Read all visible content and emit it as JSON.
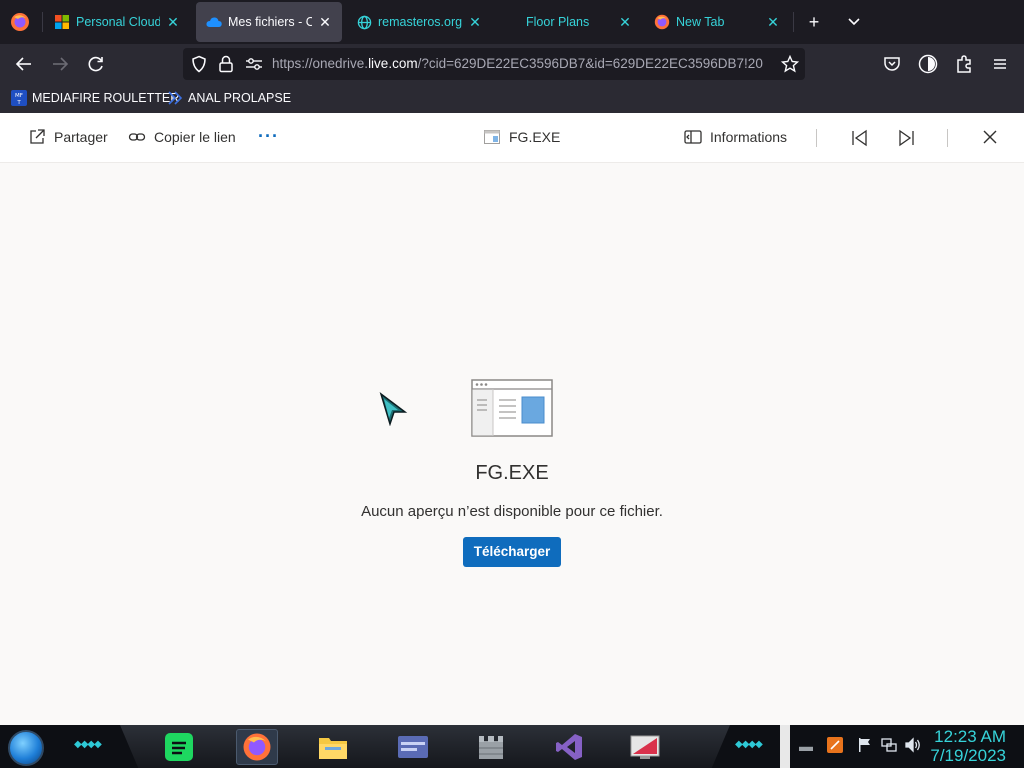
{
  "browser": {
    "tabs": [
      {
        "title": "Personal Cloud S",
        "favicon": "microsoft-logo-icon",
        "active": false
      },
      {
        "title": "Mes fichiers - One",
        "favicon": "onedrive-cloud-icon",
        "active": true
      },
      {
        "title": "remasteros.org/i",
        "favicon": "globe-icon",
        "active": false
      },
      {
        "title": "Floor Plans",
        "favicon": "none",
        "active": false
      },
      {
        "title": "New Tab",
        "favicon": "firefox-icon",
        "active": false
      }
    ],
    "url": {
      "prefix": "https://onedrive.",
      "domain": "live.com",
      "rest": "/?cid=629DE22EC3596DB7&id=629DE22EC3596DB7!20"
    },
    "bookmarks": [
      {
        "label": "MEDIAFIRE ROULETTER",
        "icon": "mediafire-icon"
      },
      {
        "label": "ANAL PROLAPSE",
        "icon": "bookmark-folder-icon"
      }
    ]
  },
  "viewer": {
    "share_label": "Partager",
    "copy_link_label": "Copier le lien",
    "more_label": "···",
    "file_title": "FG.EXE",
    "info_label": "Informations",
    "file_name": "FG.EXE",
    "no_preview": "Aucun aperçu n’est disponible pour ce fichier.",
    "download_label": "Télécharger"
  },
  "taskbar": {
    "time": "12:23 AM",
    "date": "7/19/2023"
  },
  "colors": {
    "accent": "#0f6cbd",
    "tab_text": "#36d3d9",
    "clock": "#36d3d9"
  }
}
